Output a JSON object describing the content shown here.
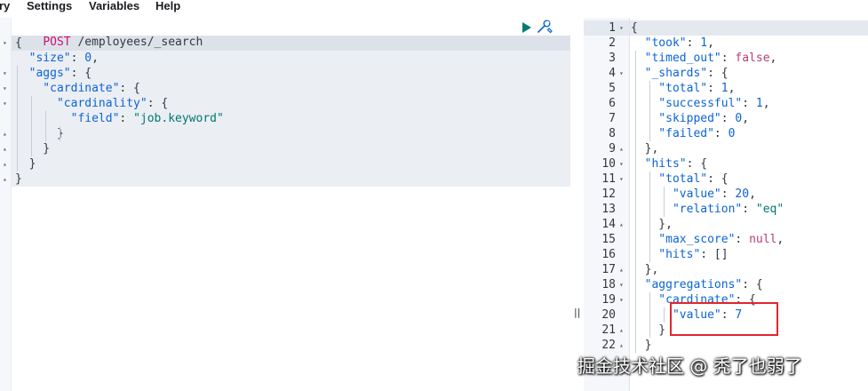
{
  "menu": {
    "items": [
      "ry",
      "Settings",
      "Variables",
      "Help"
    ]
  },
  "request": {
    "method": "POST",
    "url": " /employees/_search",
    "lines": [
      [
        {
          "t": "{",
          "c": "punc"
        }
      ],
      [
        {
          "t": "  \"size\"",
          "c": "key"
        },
        {
          "t": ": ",
          "c": "punc"
        },
        {
          "t": "0",
          "c": "num"
        },
        {
          "t": ",",
          "c": "punc"
        }
      ],
      [
        {
          "t": "  \"aggs\"",
          "c": "key"
        },
        {
          "t": ": {",
          "c": "punc"
        }
      ],
      [
        {
          "t": "    \"cardinate\"",
          "c": "key"
        },
        {
          "t": ": {",
          "c": "punc"
        }
      ],
      [
        {
          "t": "      \"cardinality\"",
          "c": "key"
        },
        {
          "t": ": {",
          "c": "punc"
        }
      ],
      [
        {
          "t": "        \"field\"",
          "c": "key"
        },
        {
          "t": ": ",
          "c": "punc"
        },
        {
          "t": "\"job.keyword\"",
          "c": "str"
        }
      ],
      [
        {
          "t": "      }",
          "c": "punc"
        }
      ],
      [
        {
          "t": "    }",
          "c": "punc"
        }
      ],
      [
        {
          "t": "  }",
          "c": "punc"
        }
      ],
      [
        {
          "t": "}",
          "c": "punc"
        }
      ]
    ],
    "fold_markers": [
      "▾",
      "",
      "▾",
      "▾",
      "▾",
      "",
      "▴",
      "▴",
      "▴",
      "▴"
    ]
  },
  "response": {
    "lines": [
      [
        {
          "t": "{",
          "c": "punc"
        }
      ],
      [
        {
          "t": "  \"took\"",
          "c": "key"
        },
        {
          "t": ": ",
          "c": "punc"
        },
        {
          "t": "1",
          "c": "num"
        },
        {
          "t": ",",
          "c": "punc"
        }
      ],
      [
        {
          "t": "  \"timed_out\"",
          "c": "key"
        },
        {
          "t": ": ",
          "c": "punc"
        },
        {
          "t": "false",
          "c": "bool"
        },
        {
          "t": ",",
          "c": "punc"
        }
      ],
      [
        {
          "t": "  \"_shards\"",
          "c": "key"
        },
        {
          "t": ": {",
          "c": "punc"
        }
      ],
      [
        {
          "t": "    \"total\"",
          "c": "key"
        },
        {
          "t": ": ",
          "c": "punc"
        },
        {
          "t": "1",
          "c": "num"
        },
        {
          "t": ",",
          "c": "punc"
        }
      ],
      [
        {
          "t": "    \"successful\"",
          "c": "key"
        },
        {
          "t": ": ",
          "c": "punc"
        },
        {
          "t": "1",
          "c": "num"
        },
        {
          "t": ",",
          "c": "punc"
        }
      ],
      [
        {
          "t": "    \"skipped\"",
          "c": "key"
        },
        {
          "t": ": ",
          "c": "punc"
        },
        {
          "t": "0",
          "c": "num"
        },
        {
          "t": ",",
          "c": "punc"
        }
      ],
      [
        {
          "t": "    \"failed\"",
          "c": "key"
        },
        {
          "t": ": ",
          "c": "punc"
        },
        {
          "t": "0",
          "c": "num"
        }
      ],
      [
        {
          "t": "  },",
          "c": "punc"
        }
      ],
      [
        {
          "t": "  \"hits\"",
          "c": "key"
        },
        {
          "t": ": {",
          "c": "punc"
        }
      ],
      [
        {
          "t": "    \"total\"",
          "c": "key"
        },
        {
          "t": ": {",
          "c": "punc"
        }
      ],
      [
        {
          "t": "      \"value\"",
          "c": "key"
        },
        {
          "t": ": ",
          "c": "punc"
        },
        {
          "t": "20",
          "c": "num"
        },
        {
          "t": ",",
          "c": "punc"
        }
      ],
      [
        {
          "t": "      \"relation\"",
          "c": "key"
        },
        {
          "t": ": ",
          "c": "punc"
        },
        {
          "t": "\"eq\"",
          "c": "str"
        }
      ],
      [
        {
          "t": "    },",
          "c": "punc"
        }
      ],
      [
        {
          "t": "    \"max_score\"",
          "c": "key"
        },
        {
          "t": ": ",
          "c": "punc"
        },
        {
          "t": "null",
          "c": "bool"
        },
        {
          "t": ",",
          "c": "punc"
        }
      ],
      [
        {
          "t": "    \"hits\"",
          "c": "key"
        },
        {
          "t": ": []",
          "c": "punc"
        }
      ],
      [
        {
          "t": "  },",
          "c": "punc"
        }
      ],
      [
        {
          "t": "  \"aggregations\"",
          "c": "key"
        },
        {
          "t": ": {",
          "c": "punc"
        }
      ],
      [
        {
          "t": "    \"cardinate\"",
          "c": "key"
        },
        {
          "t": ": {",
          "c": "punc"
        }
      ],
      [
        {
          "t": "      \"value\"",
          "c": "key"
        },
        {
          "t": ": ",
          "c": "punc"
        },
        {
          "t": "7",
          "c": "num"
        }
      ],
      [
        {
          "t": "    }",
          "c": "punc"
        }
      ],
      [
        {
          "t": "  }",
          "c": "punc"
        }
      ]
    ],
    "line_numbers": [
      "1",
      "2",
      "3",
      "4",
      "5",
      "6",
      "7",
      "8",
      "9",
      "10",
      "11",
      "12",
      "13",
      "14",
      "15",
      "16",
      "17",
      "18",
      "19",
      "20",
      "21",
      "22"
    ],
    "fold_markers": [
      "▾",
      "",
      "",
      "▾",
      "",
      "",
      "",
      "",
      "▴",
      "▾",
      "▾",
      "",
      "",
      "▴",
      "",
      "",
      "▴",
      "▾",
      "▾",
      "",
      "▴",
      "▴"
    ]
  },
  "icons": {
    "run": "play-icon",
    "settings": "wrench-icon",
    "resize": "splitter-handle"
  },
  "splitter_glyph": "||",
  "watermark": "掘金技术社区 @ 秃了也弱了",
  "colors": {
    "key": "#0b64d6",
    "string": "#007871",
    "method": "#c6156f",
    "highlight": "#e0262e"
  }
}
